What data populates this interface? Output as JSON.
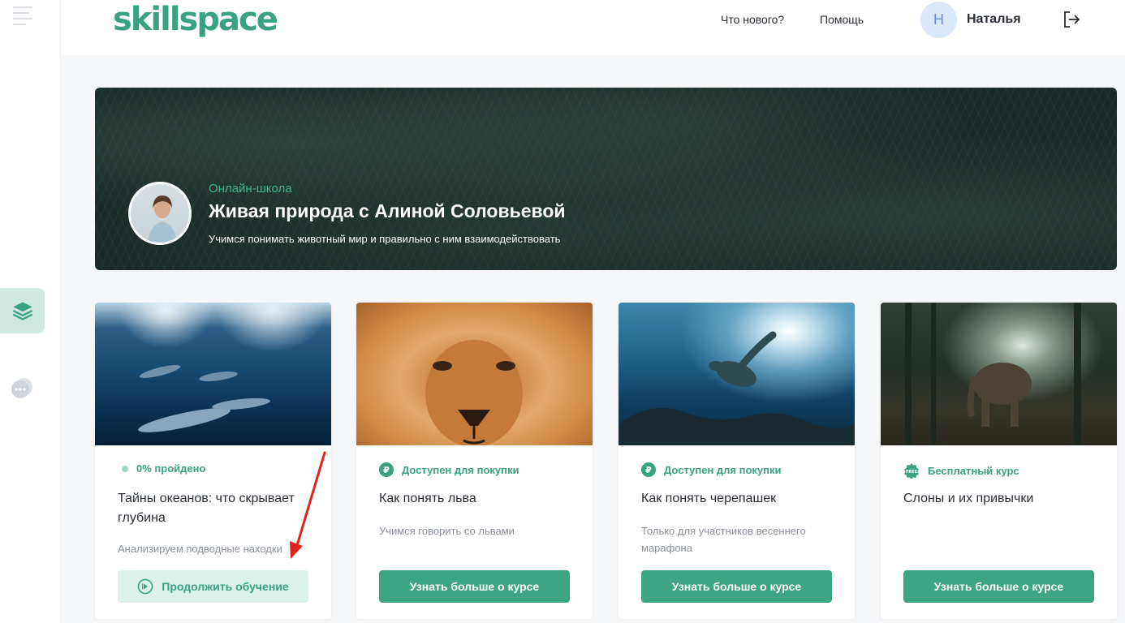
{
  "header": {
    "logo": "skillspace",
    "nav": [
      "Что нового?",
      "Помощь"
    ],
    "user_initial": "Н",
    "user_name": "Наталья"
  },
  "banner": {
    "label": "Онлайн-школа",
    "title": "Живая природа с Алиной Соловьевой",
    "subtitle": "Учимся понимать животный мир и правильно с ним взаимодействовать"
  },
  "cards": [
    {
      "status": "0% пройдено",
      "title": "Тайны океанов: что скрывает глубина",
      "description": "Анализируем подводные находки",
      "button": "Продолжить обучение",
      "image": "dolphins-underwater"
    },
    {
      "status": "Доступен для покупки",
      "title": "Как понять льва",
      "description": "Учимся говорить со львами",
      "button": "Узнать больше о курсе",
      "image": "lion-face"
    },
    {
      "status": "Доступен для покупки",
      "title": "Как понять черепашек",
      "description": "Только для участников весеннего марафона",
      "button": "Узнать больше о курсе",
      "image": "sea-turtle"
    },
    {
      "status": "Бесплатный курс",
      "title": "Слоны и их привычки",
      "description": "",
      "button": "Узнать больше о курсе",
      "image": "elephant-forest",
      "free_badge": "FREE"
    }
  ],
  "icons": {
    "ruble": "₽",
    "courses": "layers-icon",
    "chat": "chat-icon",
    "logout": "logout-icon",
    "play": "play-circle-icon"
  },
  "colors": {
    "accent": "#3ea584",
    "accent_light": "#dbf2ea",
    "annotation_arrow": "#e0221c"
  }
}
